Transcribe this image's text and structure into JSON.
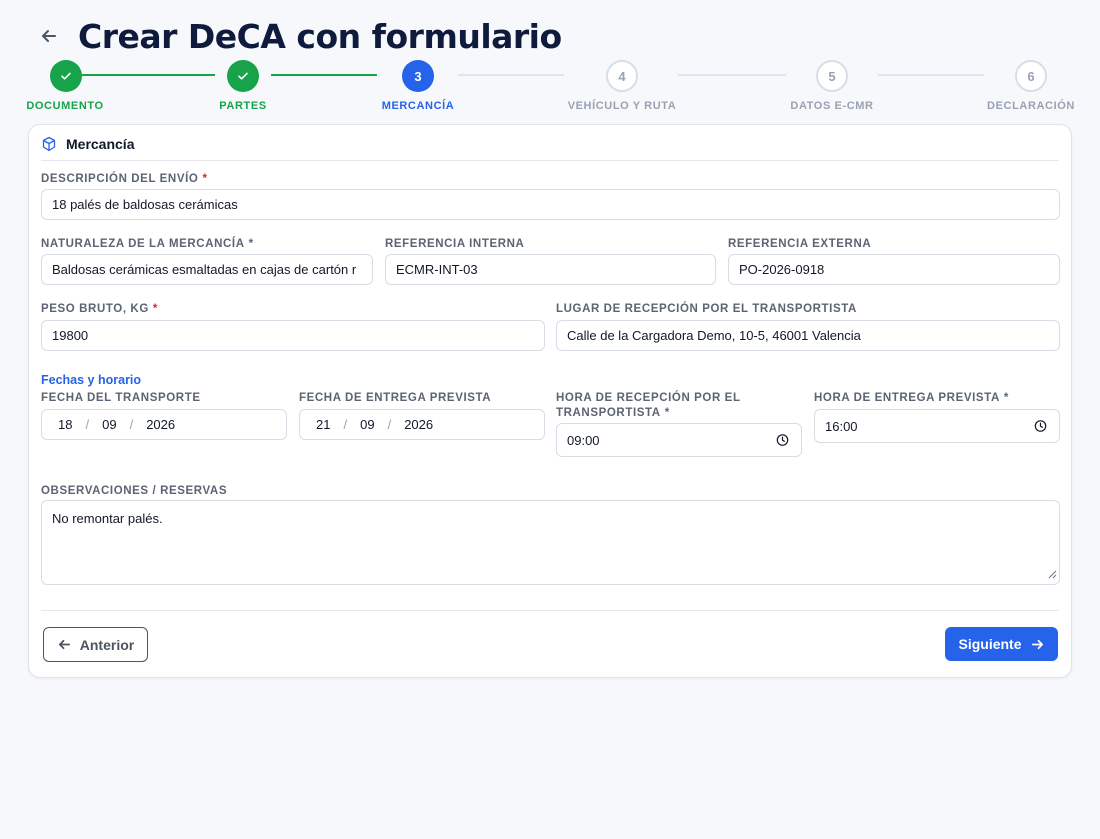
{
  "page": {
    "title": "Crear DeCA con formulario"
  },
  "colors": {
    "done": "#16a34a",
    "active": "#2563eb",
    "pending": "#98a2b3",
    "danger": "#dc2626"
  },
  "stepper": {
    "steps": [
      {
        "number": "1",
        "label": "DOCUMENTO",
        "status": "done"
      },
      {
        "number": "2",
        "label": "PARTES",
        "status": "done"
      },
      {
        "number": "3",
        "label": "MERCANCÍA",
        "status": "active"
      },
      {
        "number": "4",
        "label": "VEHÍCULO Y RUTA",
        "status": "pending"
      },
      {
        "number": "5",
        "label": "DATOS E-CMR",
        "status": "pending"
      },
      {
        "number": "6",
        "label": "DECLARACIÓN",
        "status": "pending"
      }
    ]
  },
  "card": {
    "title": "Mercancía",
    "icon": "box-icon",
    "fields": {
      "descripcion": {
        "label": "DESCRIPCIÓN DEL ENVÍO",
        "required": "*",
        "value": "18 palés de baldosas cerámicas"
      },
      "naturaleza": {
        "label": "NATURALEZA DE LA MERCANCÍA",
        "required": "*",
        "value": "Baldosas cerámicas esmaltadas en cajas de cartón r"
      },
      "ref_interna": {
        "label": "REFERENCIA INTERNA",
        "value": "ECMR-INT-03"
      },
      "ref_externa": {
        "label": "REFERENCIA EXTERNA",
        "value": "PO-2026-0918"
      },
      "peso": {
        "label": "PESO BRUTO, KG",
        "required": "*",
        "value": "19800"
      },
      "lugar": {
        "label": "LUGAR DE RECEPCIÓN POR EL TRANSPORTISTA",
        "value": "Calle de la Cargadora Demo, 10-5, 46001 Valencia"
      }
    },
    "schedule": {
      "heading": "Fechas y horario",
      "fecha_transporte": {
        "label": "FECHA DEL TRANSPORTE",
        "day": "18",
        "month": "09",
        "year": "2026"
      },
      "fecha_entrega": {
        "label": "FECHA DE ENTREGA PREVISTA",
        "day": "21",
        "month": "09",
        "year": "2026"
      },
      "hora_recepcion": {
        "label_line1": "HORA DE RECEPCIÓN POR EL",
        "label_line2": "TRANSPORTISTA",
        "required": "*",
        "value": "09:00"
      },
      "hora_entrega": {
        "label": "HORA DE ENTREGA PREVISTA",
        "required": "*",
        "value": "16:00"
      }
    },
    "observaciones": {
      "label": "OBSERVACIONES / RESERVAS",
      "value": "No remontar palés."
    },
    "buttons": {
      "prev": "Anterior",
      "next": "Siguiente"
    }
  }
}
